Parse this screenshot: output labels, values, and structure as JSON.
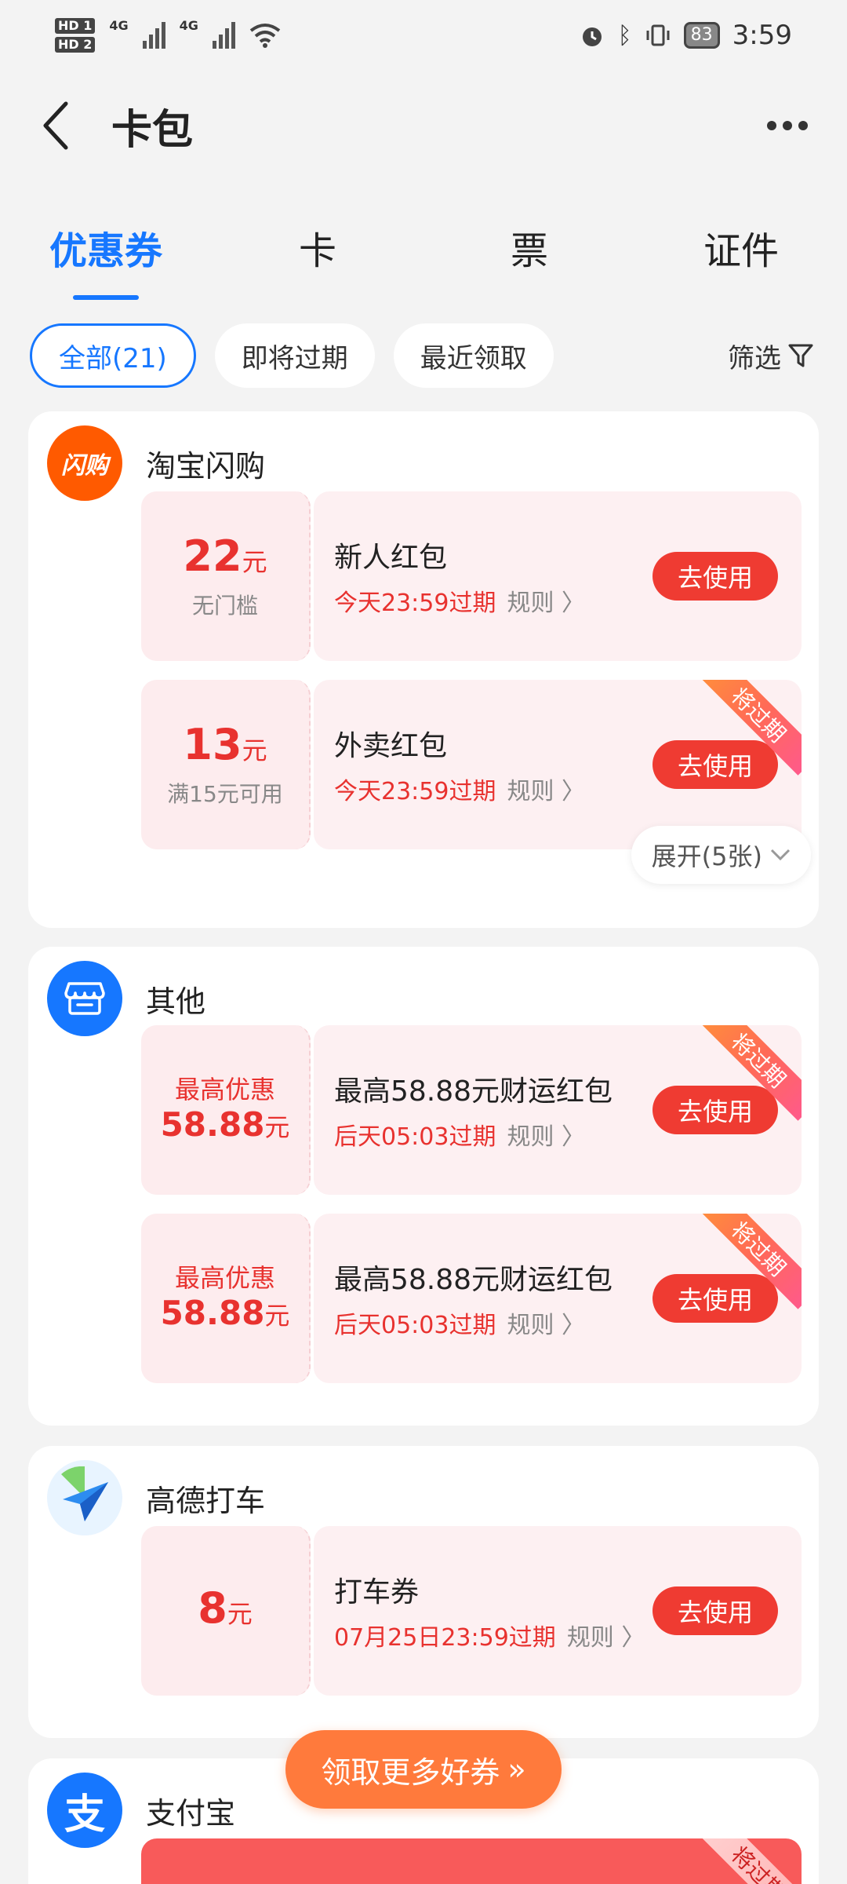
{
  "status_bar": {
    "hd1": "HD 1",
    "hd2": "HD 2",
    "net1": "4G",
    "net2": "4G",
    "battery": "83",
    "time": "3:59"
  },
  "header": {
    "title": "卡包",
    "back_icon": "chevron-left-icon",
    "more_icon": "more-dots-icon"
  },
  "tabs": [
    {
      "label": "优惠券",
      "active": true
    },
    {
      "label": "卡",
      "active": false
    },
    {
      "label": "票",
      "active": false
    },
    {
      "label": "证件",
      "active": false
    }
  ],
  "filters": {
    "chips": [
      {
        "label": "全部(21)",
        "active": true
      },
      {
        "label": "即将过期",
        "active": false
      },
      {
        "label": "最近领取",
        "active": false
      }
    ],
    "filter_label": "筛选"
  },
  "groups": [
    {
      "merchant": "淘宝闪购",
      "logo_text": "闪购",
      "logo_color": "#ff5a00",
      "coupons": [
        {
          "amount": "22",
          "unit": "元",
          "condition": "无门槛",
          "title": "新人红包",
          "expire": "今天23:59过期",
          "rule": "规则",
          "button": "去使用",
          "ribbon": ""
        },
        {
          "amount": "13",
          "unit": "元",
          "condition": "满15元可用",
          "title": "外卖红包",
          "expire": "今天23:59过期",
          "rule": "规则",
          "button": "去使用",
          "ribbon": "将过期"
        }
      ],
      "expand": "展开(5张)"
    },
    {
      "merchant": "其他",
      "logo_color": "#1677ff",
      "coupons": [
        {
          "max_label": "最高优惠",
          "amount": "58.88",
          "unit": "元",
          "title": "最高58.88元财运红包",
          "expire": "后天05:03过期",
          "rule": "规则",
          "button": "去使用",
          "ribbon": "将过期"
        },
        {
          "max_label": "最高优惠",
          "amount": "58.88",
          "unit": "元",
          "title": "最高58.88元财运红包",
          "expire": "后天05:03过期",
          "rule": "规则",
          "button": "去使用",
          "ribbon": "将过期"
        }
      ]
    },
    {
      "merchant": "高德打车",
      "logo_color": "#2d8cf0",
      "coupons": [
        {
          "amount": "8",
          "unit": "元",
          "title": "打车券",
          "expire": "07月25日23:59过期",
          "rule": "规则",
          "button": "去使用",
          "ribbon": ""
        }
      ]
    },
    {
      "merchant": "支付宝",
      "logo_text": "支",
      "logo_color": "#1677ff",
      "coupons": [
        {
          "ribbon": "将过期"
        }
      ]
    }
  ],
  "cta": {
    "label": "领取更多好券"
  },
  "colors": {
    "accent": "#1677ff",
    "coupon_red": "#e8322f",
    "button_red": "#ef3b32",
    "cta_orange": "#ff7a3c"
  }
}
